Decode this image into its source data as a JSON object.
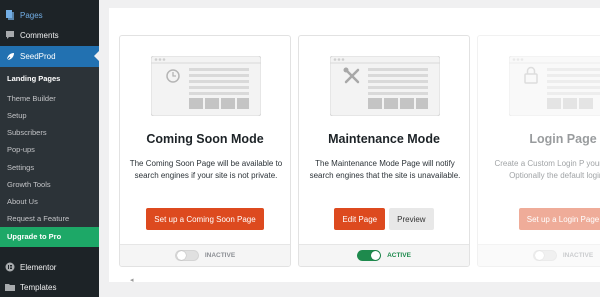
{
  "sidebar": {
    "pages": "Pages",
    "comments": "Comments",
    "seedprod": "SeedProd",
    "submenu": [
      "Landing Pages",
      "Theme Builder",
      "Setup",
      "Subscribers",
      "Pop-ups",
      "Settings",
      "Growth Tools",
      "About Us",
      "Request a Feature"
    ],
    "upgrade": "Upgrade to Pro",
    "elementor": "Elementor",
    "templates": "Templates"
  },
  "cards": [
    {
      "title": "Coming Soon Mode",
      "desc": "The Coming Soon Page will be available to search engines if your site is not private.",
      "primary": "Set up a Coming Soon Page",
      "status": "INACTIVE",
      "icon": "clock-icon"
    },
    {
      "title": "Maintenance Mode",
      "desc": "The Maintenance Mode Page will notify search engines that the site is unavailable.",
      "primary": "Edit Page",
      "secondary": "Preview",
      "status": "ACTIVE",
      "icon": "tools-icon"
    },
    {
      "title": "Login Page",
      "desc": "Create a Custom Login P your website. Optionally the default login pag",
      "primary": "Set up a Login Page",
      "status": "INACTIVE",
      "icon": "lock-icon"
    }
  ],
  "colors": {
    "accent": "#dd4a1f",
    "active": "#1e8a4d",
    "sidebar": "#1d2327",
    "highlight": "#2271b1",
    "upgrade": "#1da867"
  }
}
